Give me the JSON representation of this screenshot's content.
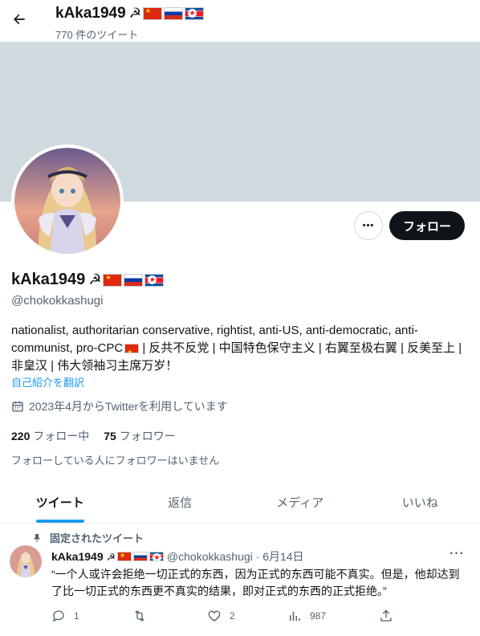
{
  "header": {
    "name": "kAka1949",
    "tweet_count": "770 件のツイート"
  },
  "profile": {
    "name": "kAka1949",
    "name_symbol": "☭",
    "handle": "@chokokkashugi",
    "follow_label": "フォロー",
    "more_label": "•••",
    "bio_part1": "nationalist, authoritarian conservative, rightist, anti-US, anti-democratic, anti-communist, pro-CPC",
    "bio_part2": " | 反共不反党 | 中国特色保守主义 | 右翼至极右翼 | 反美至上 | 非皇汉 | 伟大领袖习主席万岁！",
    "translate_label": "自己紹介を翻訳",
    "joined": "2023年4月からTwitterを利用しています",
    "following_count": "220",
    "following_label": "フォロー中",
    "followers_count": "75",
    "followers_label": "フォロワー",
    "no_mutuals": "フォローしている人にフォロワーはいません"
  },
  "tabs": [
    {
      "label": "ツイート"
    },
    {
      "label": "返信"
    },
    {
      "label": "メディア"
    },
    {
      "label": "いいね"
    }
  ],
  "tweet": {
    "pinned_label": "固定されたツイート",
    "name": "kAka1949",
    "meta": "@chokokkashugi · 6月14日",
    "text": "“一个人或许会拒绝一切正式的东西，因为正式的东西可能不真实。但是，他却达到了比一切正式的东西更不真实的结果，即对正式的东西的正式拒绝。”",
    "replies": "1",
    "retweets": "",
    "likes": "2",
    "views": "987"
  },
  "icons": [
    "back-arrow-icon",
    "calendar-icon",
    "pin-icon",
    "reply-icon",
    "retweet-icon",
    "like-icon",
    "views-icon",
    "share-icon"
  ],
  "colors": {
    "accent": "#1d9bf0",
    "banner": "#cfd9de",
    "follow_bg": "#0f1419"
  }
}
